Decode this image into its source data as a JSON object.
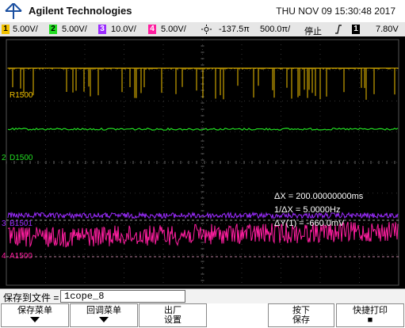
{
  "header": {
    "brand": "Agilent Technologies",
    "datetime": "THU NOV 09 15:30:48 2017"
  },
  "status": {
    "ch1_num": "1",
    "ch1_scale": "5.00V/",
    "ch2_num": "2",
    "ch2_scale": "5.00V/",
    "ch3_num": "3",
    "ch3_scale": "10.0V/",
    "ch4_num": "4",
    "ch4_scale": "5.00V/",
    "trigger_icon": "sun-trigger-icon",
    "delay": "-137.5π",
    "timebase": "500.0π/",
    "run_state": "停止",
    "edge_icon": "rising-edge-icon",
    "trig_ch": "1",
    "trig_level": "7.80V"
  },
  "channels": {
    "r": "R1500",
    "d": "D1500",
    "b": "B1501",
    "a": "A1500"
  },
  "markers": {
    "d": "2",
    "b": "3",
    "a": "4"
  },
  "measurements": {
    "dx": "ΔX = 200.00000000ms",
    "inv_dx": "1/ΔX = 5.0000Hz",
    "dy": "ΔY(1) = -660.0mV"
  },
  "save_bar": {
    "label": "保存到文件 =",
    "filename": "1cope_8"
  },
  "softkeys": {
    "save_menu": "保存菜单",
    "recall_menu": "回调菜单",
    "default_line1": "出厂",
    "default_line2": "设置",
    "press_line1": "按下",
    "press_line2": "保存",
    "quick_print_line1": "快捷打印",
    "quick_print_icon": "■"
  },
  "colors": {
    "ch1": "#f2c200",
    "ch2": "#22dd22",
    "ch3": "#9b2cff",
    "ch4": "#ff1ea0",
    "screen": "#000000"
  }
}
